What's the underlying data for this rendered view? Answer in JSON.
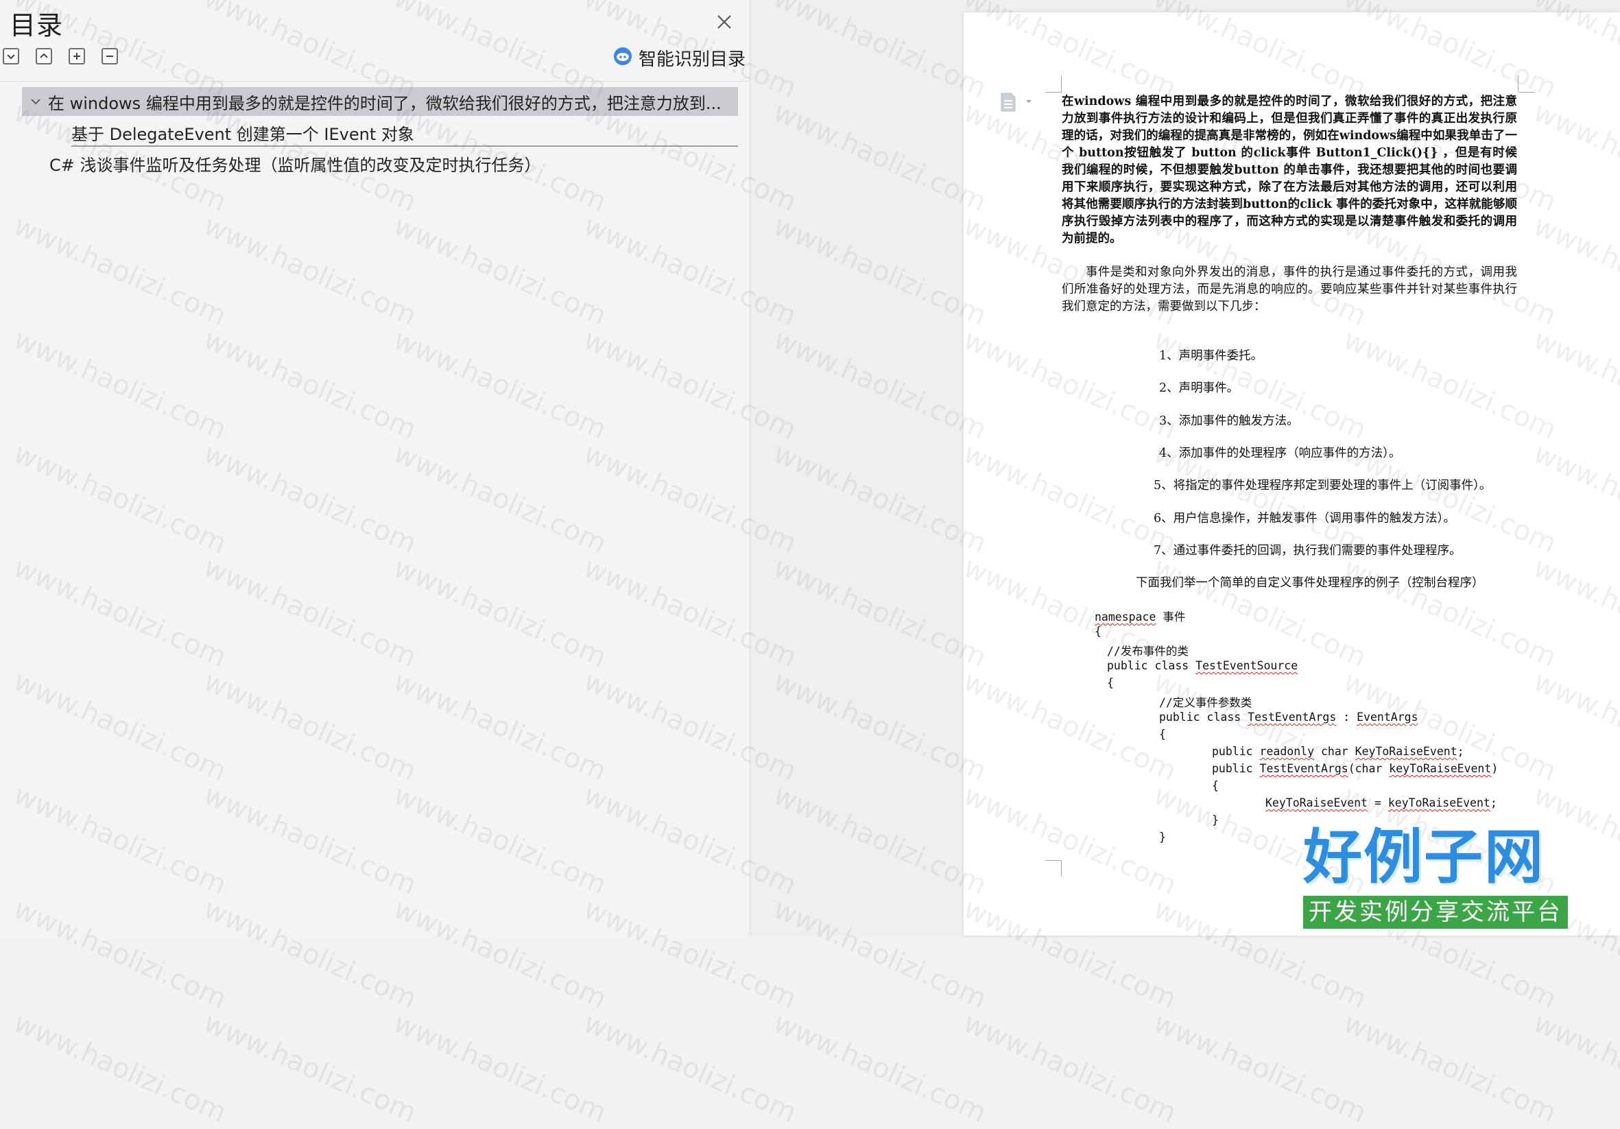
{
  "toc": {
    "title": "目录",
    "close_icon": "close-icon",
    "toolbar": {
      "buttons": [
        "collapse-all-icon",
        "expand-all-icon",
        "add-item-icon",
        "remove-item-icon"
      ],
      "smart_label": "智能识别目录"
    },
    "items": [
      {
        "level": 1,
        "expanded": true,
        "selected": true,
        "label": "在 windows  编程中用到最多的就是控件的时间了，微软给我们很好的方式，把注意力放到..."
      },
      {
        "level": 2,
        "label": "基于 DelegateEvent 创建第一个 IEvent 对象"
      },
      {
        "level": 1,
        "label": "C#  浅谈事件监听及任务处理（监听属性值的改变及定时执行任务）"
      }
    ]
  },
  "document": {
    "para1": "在windows 编程中用到最多的就是控件的时间了，微软给我们很好的方式，把注意力放到事件执行方法的设计和编码上，但是但我们真正弄懂了事件的真正出发执行原理的话，对我们的编程的提高真是非常榜的，例如在windows编程中如果我单击了一个 button按钮触发了 button 的click事件 Button1_Click(){} ，但是有时候我们编程的时候，不但想要触发button 的单击事件，我还想要把其他的时间也要调用下来顺序执行，要实现这种方式，除了在方法最后对其他方法的调用，还可以利用将其他需要顺序执行的方法封装到button的click 事件的委托对象中，这样就能够顺序执行毁掉方法列表中的程序了，而这种方式的实现是以清楚事件触发和委托的调用为前提的。",
    "para2": "事件是类和对象向外界发出的消息，事件的执行是通过事件委托的方式，调用我们所准备好的处理方法，而是先消息的响应的。要响应某些事件并针对某些事件执行我们意定的方法，需要做到以下几步：",
    "steps": [
      "1、声明事件委托。",
      "2、声明事件。",
      "3、添加事件的触发方法。",
      "4、添加事件的处理程序（响应事件的方法）。",
      "5、将指定的事件处理程序邦定到要处理的事件上（订阅事件）。",
      "6、用户信息操作，并触发事件（调用事件的触发方法）。",
      "7、通过事件委托的回调，执行我们需要的事件处理程序。"
    ],
    "intro": "下面我们举一个简单的自定义事件处理程序的例子（控制台程序）",
    "code": {
      "l1_kw": "namespace",
      "l1_name": " 事件",
      "l2": "{",
      "l3": "//发布事件的类",
      "l4_a": "public class ",
      "l4_b": "TestEventSource",
      "l5": "{",
      "l6": "//定义事件参数类",
      "l7_a": "public class ",
      "l7_b": "TestEventArgs",
      "l7_c": " : ",
      "l7_d": "EventArgs",
      "l8": "{",
      "l9_a": "public ",
      "l9_b": "readonly",
      "l9_c": " char ",
      "l9_d": "KeyToRaiseEvent",
      "l9_e": ";",
      "l10_a": "public ",
      "l10_b": "TestEventArgs",
      "l10_c": "(char ",
      "l10_d": "keyToRaiseEvent",
      "l10_e": ")",
      "l11": "{",
      "l12_a": "KeyToRaiseEvent",
      "l12_b": " = ",
      "l12_c": "keyToRaiseEvent",
      "l12_d": ";",
      "l13": "}",
      "l14": "}"
    }
  },
  "watermark": {
    "text": "www.haolizi.com"
  },
  "logo": {
    "main": "好例子网",
    "sub": "开发实例分享交流平台"
  }
}
